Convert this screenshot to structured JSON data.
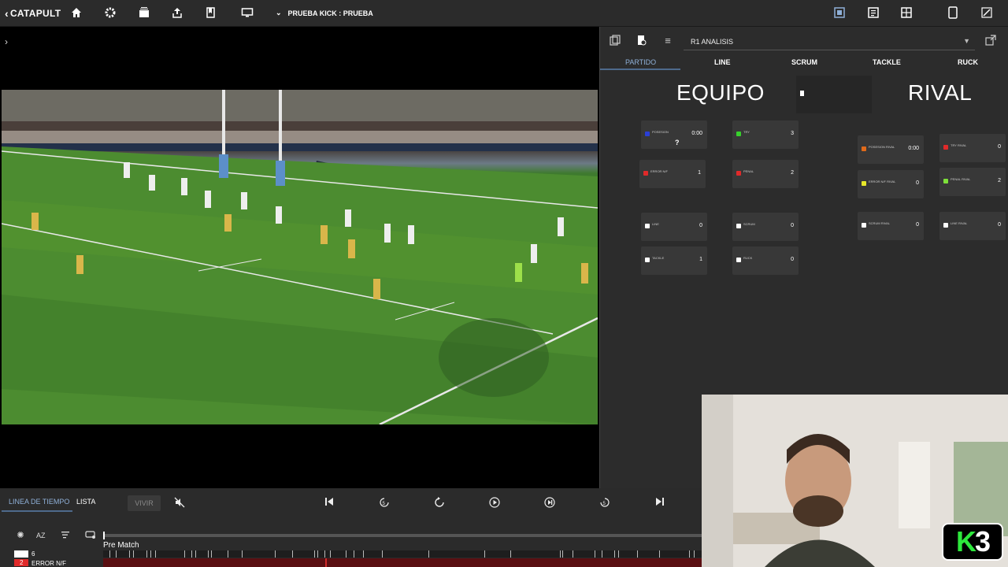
{
  "topbar": {
    "brand": "CATAPULT",
    "project_title": "PRUEBA KICK : PRUEBA"
  },
  "panel": {
    "selector_value": "R1 ANALISIS",
    "tabs": [
      "PARTIDO",
      "LINE",
      "SCRUM",
      "TACKLE",
      "RUCK"
    ],
    "team_label": "EQUIPO",
    "rival_label": "RIVAL",
    "equipo_stats": [
      {
        "label": "POSESION",
        "value": "0:00",
        "color": "#2a3fd6"
      },
      {
        "label": "TRY",
        "value": "3",
        "color": "#37d12c"
      },
      {
        "label": "ERROR N/F",
        "value": "1",
        "color": "#e02a2a"
      },
      {
        "label": "PENAL",
        "value": "2",
        "color": "#e02a2a"
      },
      {
        "label": "LINE",
        "value": "0",
        "color": "#ffffff"
      },
      {
        "label": "SCRUM",
        "value": "0",
        "color": "#ffffff"
      },
      {
        "label": "TACKLE",
        "value": "1",
        "color": "#ffffff"
      },
      {
        "label": "RUCK",
        "value": "0",
        "color": "#ffffff"
      }
    ],
    "posesion_extra": "?",
    "rival_stats": [
      {
        "label": "POSESION RIVAL",
        "value": "0:00",
        "color": "#e06a1a"
      },
      {
        "label": "TRY RIVAL",
        "value": "0",
        "color": "#e02a2a"
      },
      {
        "label": "ERROR N/F RIVAL",
        "value": "0",
        "color": "#e8e82a"
      },
      {
        "label": "PENAL RIVAL",
        "value": "2",
        "color": "#7ee03a"
      },
      {
        "label": "SCRUM RIVAL",
        "value": "0",
        "color": "#ffffff"
      },
      {
        "label": "LINE RIVAL",
        "value": "0",
        "color": "#ffffff"
      }
    ]
  },
  "bottom": {
    "tab_timeline": "LINEA DE TIEMPO",
    "tab_list": "LISTA",
    "live_button": "VIVIR",
    "pre_match_label": "Pre Match",
    "row1_count": "6",
    "row2_count": "2",
    "row2_label": "ERROR N/F"
  },
  "overlay": {
    "logo_k": "K",
    "logo_3": "3"
  },
  "colors": {
    "accent": "#8fb0d8",
    "panel_bg": "#2c2c2c",
    "bar_bg": "#2b2b2b"
  }
}
